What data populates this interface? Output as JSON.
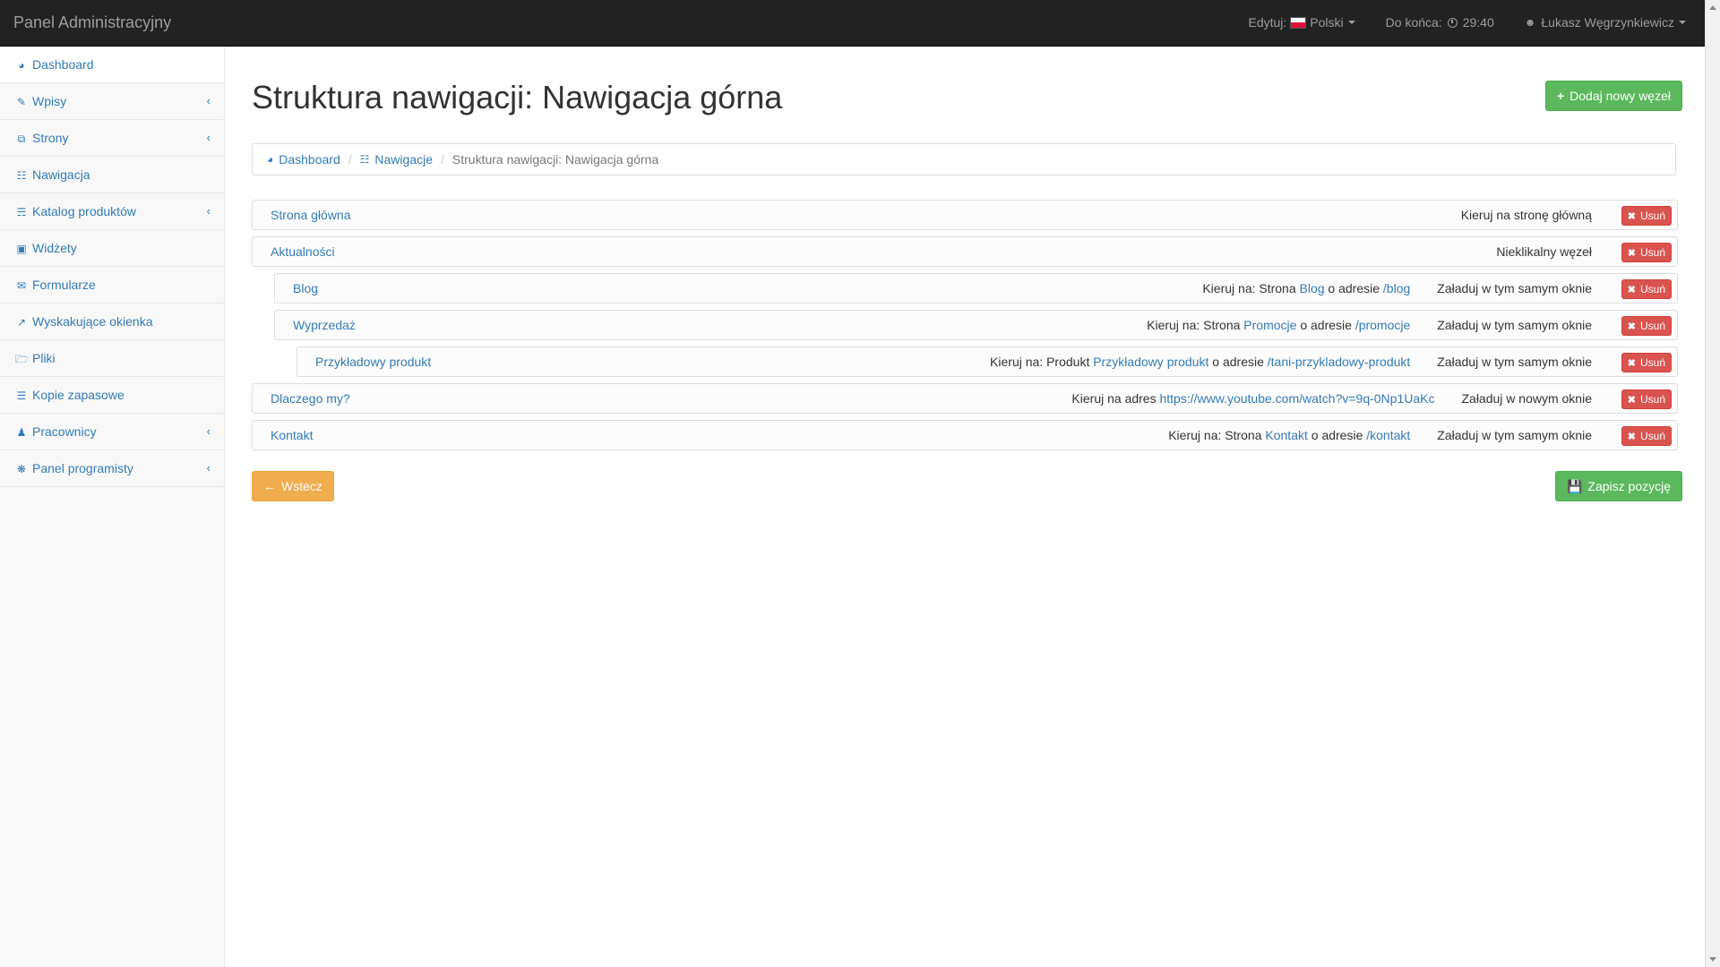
{
  "topbar": {
    "brand": "Panel Administracyjny",
    "edit_label": "Edytuj:",
    "language": "Polski",
    "time_label": "Do końca:",
    "time_value": "29:40",
    "user": "Łukasz Węgrzynkiewicz"
  },
  "sidebar": {
    "items": [
      {
        "label": "Dashboard",
        "icon": "dashboard-icon",
        "has_arrow": false
      },
      {
        "label": "Wpisy",
        "icon": "edit-icon",
        "has_arrow": true
      },
      {
        "label": "Strony",
        "icon": "pages-icon",
        "has_arrow": true
      },
      {
        "label": "Nawigacja",
        "icon": "sitemap-icon",
        "has_arrow": false
      },
      {
        "label": "Katalog produktów",
        "icon": "basket-icon",
        "has_arrow": true
      },
      {
        "label": "Widżety",
        "icon": "cube-icon",
        "has_arrow": false
      },
      {
        "label": "Formularze",
        "icon": "envelope-icon",
        "has_arrow": false
      },
      {
        "label": "Wyskakujące okienka",
        "icon": "external-link-icon",
        "has_arrow": false
      },
      {
        "label": "Pliki",
        "icon": "folder-icon",
        "has_arrow": false
      },
      {
        "label": "Kopie zapasowe",
        "icon": "database-icon",
        "has_arrow": false
      },
      {
        "label": "Pracownicy",
        "icon": "users-icon",
        "has_arrow": true
      },
      {
        "label": "Panel programisty",
        "icon": "bug-icon",
        "has_arrow": true
      }
    ]
  },
  "main": {
    "title": "Struktura nawigacji: Nawigacja górna",
    "add_button": "Dodaj nowy węzeł",
    "breadcrumb": {
      "dashboard": "Dashboard",
      "navigations": "Nawigacje",
      "current": "Struktura nawigacji: Nawigacja górna"
    },
    "delete_label": "Usuń",
    "nodes": [
      {
        "title": "Strona główna",
        "target": "Kieruj na stronę główną",
        "mode": ""
      },
      {
        "title": "Aktualności",
        "target": "Nieklikalny węzeł",
        "mode": ""
      },
      {
        "title": "Blog",
        "prefix": "Kieruj na: Strona ",
        "link": "Blog",
        "mid": " o adresie ",
        "path": "/blog",
        "mode": "Załaduj w tym samym oknie"
      },
      {
        "title": "Wyprzedaż",
        "prefix": "Kieruj na: Strona ",
        "link": "Promocje",
        "mid": " o adresie ",
        "path": "/promocje",
        "mode": "Załaduj w tym samym oknie"
      },
      {
        "title": "Przykładowy produkt",
        "prefix": "Kieruj na: Produkt ",
        "link": "Przykładowy produkt",
        "mid": " o adresie ",
        "path": "/tani-przykladowy-produkt",
        "mode": "Załaduj w tym samym oknie"
      },
      {
        "title": "Dlaczego my?",
        "prefix": "Kieruj na adres ",
        "link": "https://www.youtube.com/watch?v=9q-0Np1UaKc",
        "mode": "Załaduj w nowym oknie"
      },
      {
        "title": "Kontakt",
        "prefix": "Kieruj na: Strona ",
        "link": "Kontakt",
        "mid": " o adresie ",
        "path": "/kontakt",
        "mode": "Załaduj w tym samym oknie"
      }
    ],
    "back_button": "Wstecz",
    "save_button": "Zapisz pozycję"
  }
}
